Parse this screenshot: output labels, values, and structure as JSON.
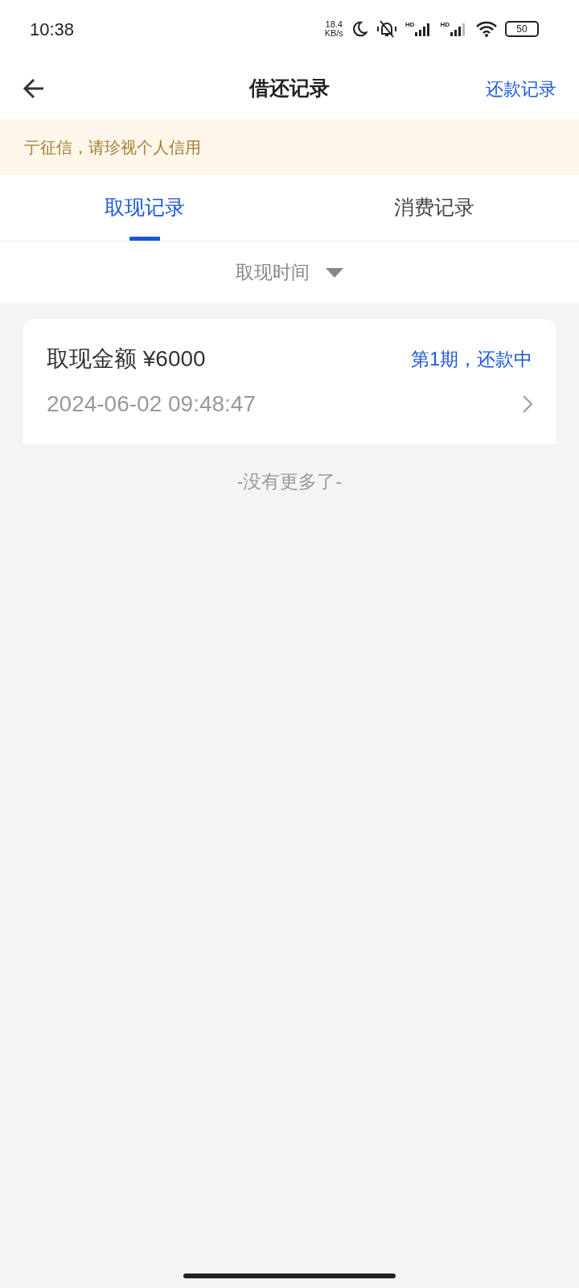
{
  "status_bar": {
    "time": "10:38",
    "net_speed": "18.4",
    "net_unit": "KB/s",
    "sim1_label": "HD",
    "sim2_label": "HD",
    "battery": "50"
  },
  "header": {
    "title": "借还记录",
    "action": "还款记录"
  },
  "notice": {
    "text": "亍征信，请珍视个人信用"
  },
  "tabs": [
    {
      "label": "取现记录",
      "selected": true
    },
    {
      "label": "消费记录",
      "selected": false
    }
  ],
  "filter": {
    "label": "取现时间"
  },
  "records": [
    {
      "title": "取现金额 ¥6000",
      "status": "第1期，还款中",
      "time": "2024-06-02 09:48:47"
    }
  ],
  "end_text": "-没有更多了-"
}
